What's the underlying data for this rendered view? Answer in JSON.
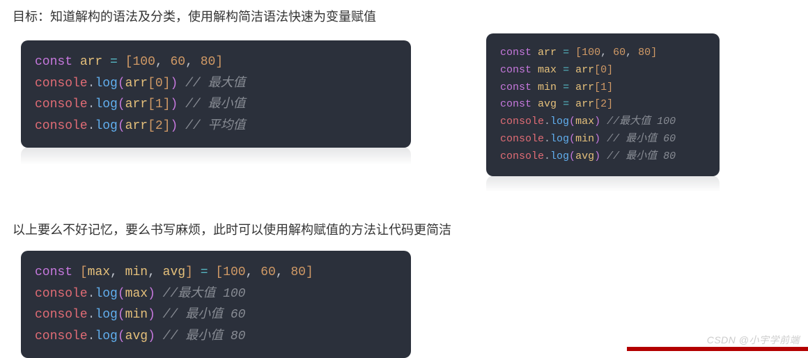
{
  "heading1": "目标：知道解构的语法及分类，使用解构简洁语法快速为变量赋值",
  "heading2": "以上要么不好记忆，要么书写麻烦，此时可以使用解构赋值的方法让代码更简洁",
  "watermark": "CSDN @小宇学前端",
  "block1": {
    "l1": {
      "kw": "const",
      "var": "arr",
      "op": "=",
      "arr_open": "[",
      "v1": "100",
      "c1": ", ",
      "v2": "60",
      "c2": ", ",
      "v3": "80",
      "arr_close": "]"
    },
    "l2": {
      "obj": "console",
      "dot": ".",
      "fn": "log",
      "po": "(",
      "arg_obj": "arr",
      "idx_o": "[",
      "idx": "0",
      "idx_c": "]",
      "pc": ")",
      "cmt": " // 最大值"
    },
    "l3": {
      "obj": "console",
      "dot": ".",
      "fn": "log",
      "po": "(",
      "arg_obj": "arr",
      "idx_o": "[",
      "idx": "1",
      "idx_c": "]",
      "pc": ")",
      "cmt": " // 最小值"
    },
    "l4": {
      "obj": "console",
      "dot": ".",
      "fn": "log",
      "po": "(",
      "arg_obj": "arr",
      "idx_o": "[",
      "idx": "2",
      "idx_c": "]",
      "pc": ")",
      "cmt": " // 平均值"
    }
  },
  "block2": {
    "l1": {
      "kw": "const",
      "var": "arr",
      "op": "=",
      "arr_open": "[",
      "v1": "100",
      "c1": ", ",
      "v2": "60",
      "c2": ", ",
      "v3": "80",
      "arr_close": "]"
    },
    "l2": {
      "kw": "const",
      "var": "max",
      "op": "=",
      "rhs_obj": "arr",
      "idx_o": "[",
      "idx": "0",
      "idx_c": "]"
    },
    "l3": {
      "kw": "const",
      "var": "min",
      "op": "=",
      "rhs_obj": "arr",
      "idx_o": "[",
      "idx": "1",
      "idx_c": "]"
    },
    "l4": {
      "kw": "const",
      "var": "avg",
      "op": "=",
      "rhs_obj": "arr",
      "idx_o": "[",
      "idx": "2",
      "idx_c": "]"
    },
    "l5": {
      "obj": "console",
      "dot": ".",
      "fn": "log",
      "po": "(",
      "arg": "max",
      "pc": ")",
      "cmt": " //最大值 100"
    },
    "l6": {
      "obj": "console",
      "dot": ".",
      "fn": "log",
      "po": "(",
      "arg": "min",
      "pc": ")",
      "cmt": " // 最小值 60"
    },
    "l7": {
      "obj": "console",
      "dot": ".",
      "fn": "log",
      "po": "(",
      "arg": "avg",
      "pc": ")",
      "cmt": " // 最小值 80"
    }
  },
  "block3": {
    "l1": {
      "kw": "const",
      "arr_open": "[",
      "v1": "max",
      "c1": ", ",
      "v2": "min",
      "c2": ", ",
      "v3": "avg",
      "arr_close": "]",
      "op": "=",
      "r_open": "[",
      "r1": "100",
      "rc1": ", ",
      "r2": "60",
      "rc2": ", ",
      "r3": "80",
      "r_close": "]"
    },
    "l2": {
      "obj": "console",
      "dot": ".",
      "fn": "log",
      "po": "(",
      "arg": "max",
      "pc": ")",
      "cmt": " //最大值 100"
    },
    "l3": {
      "obj": "console",
      "dot": ".",
      "fn": "log",
      "po": "(",
      "arg": "min",
      "pc": ")",
      "cmt": " // 最小值 60"
    },
    "l4": {
      "obj": "console",
      "dot": ".",
      "fn": "log",
      "po": "(",
      "arg": "avg",
      "pc": ")",
      "cmt": " // 最小值 80"
    }
  }
}
